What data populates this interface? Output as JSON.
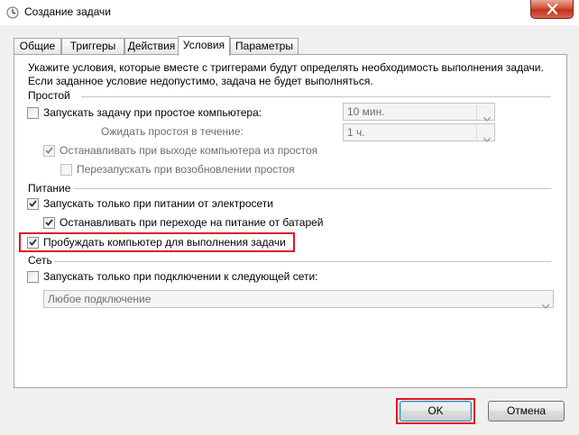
{
  "window": {
    "title": "Создание задачи"
  },
  "tabs": [
    {
      "label": "Общие",
      "active": false
    },
    {
      "label": "Триггеры",
      "active": false
    },
    {
      "label": "Действия",
      "active": false
    },
    {
      "label": "Условия",
      "active": true
    },
    {
      "label": "Параметры",
      "active": false
    }
  ],
  "description": {
    "line1": "Укажите условия, которые вместе с триггерами будут определять необходимость выполнения задачи.",
    "line2": "Если заданное условие недопустимо, задача не будет выполняться."
  },
  "idle": {
    "section_title": "Простой",
    "start_only_if_idle": {
      "label": "Запускать задачу при простое компьютера:",
      "checked": false
    },
    "idle_duration": {
      "value": "10 мин."
    },
    "wait_for_idle": {
      "label": "Ожидать простоя в течение:",
      "value": "1 ч."
    },
    "stop_if_not_idle": {
      "label": "Останавливать при выходе компьютера из простоя",
      "checked": true,
      "enabled": false
    },
    "restart_if_idle_resumes": {
      "label": "Перезапускать при возобновлении простоя",
      "checked": false,
      "enabled": false
    }
  },
  "power": {
    "section_title": "Питание",
    "ac_only": {
      "label": "Запускать только при питании от электросети",
      "checked": true
    },
    "stop_on_battery": {
      "label": "Останавливать при переходе на питание от батарей",
      "checked": true
    },
    "wake_to_run": {
      "label": "Пробуждать компьютер для выполнения задачи",
      "checked": true,
      "highlighted": true
    }
  },
  "network": {
    "section_title": "Сеть",
    "network_only": {
      "label": "Запускать только при подключении к следующей сети:",
      "checked": false
    },
    "network_select": {
      "value": "Любое подключение"
    }
  },
  "buttons": {
    "ok": "OK",
    "cancel": "Отмена"
  },
  "colors": {
    "highlight": "#e2141f",
    "window_bg": "#f0f0f0",
    "panel_bg": "#ffffff",
    "disabled_text": "#6d6d6d"
  }
}
